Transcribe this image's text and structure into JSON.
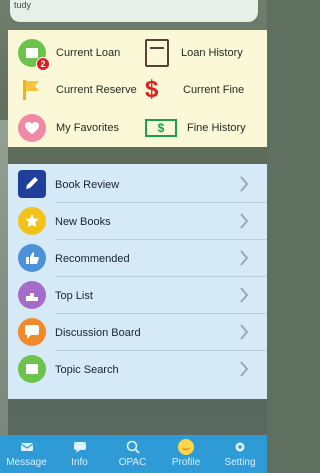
{
  "top": {
    "cut_text": "tudy"
  },
  "quick_links": [
    {
      "label": "Current Loan",
      "icon": "book-icon",
      "badge": "2"
    },
    {
      "label": "Loan History",
      "icon": "ledger-icon"
    },
    {
      "label": "Current Reserve",
      "icon": "flag-icon"
    },
    {
      "label": "Current Fine",
      "icon": "dollar-icon"
    },
    {
      "label": "My Favorites",
      "icon": "heart-icon"
    },
    {
      "label": "Fine History",
      "icon": "money-icon"
    }
  ],
  "list": [
    {
      "label": "Book Review",
      "icon": "pen-icon"
    },
    {
      "label": "New Books",
      "icon": "star-icon"
    },
    {
      "label": "Recommended",
      "icon": "thumbs-up-icon"
    },
    {
      "label": "Top List",
      "icon": "podium-icon"
    },
    {
      "label": "Discussion Board",
      "icon": "speech-bubble-icon"
    },
    {
      "label": "Topic Search",
      "icon": "open-book-icon"
    }
  ],
  "nav": [
    {
      "label": "Message",
      "icon": "mail-icon"
    },
    {
      "label": "Info",
      "icon": "chat-icon"
    },
    {
      "label": "OPAC",
      "icon": "search-icon"
    },
    {
      "label": "Profile",
      "icon": "smile-icon",
      "active": true
    },
    {
      "label": "Setting",
      "icon": "gear-icon"
    }
  ],
  "colors": {
    "top_panel": "#fbf8d7",
    "list_panel": "#d6e9f7",
    "nav_bar": "#2e9bd6",
    "badge": "#e21b1b"
  }
}
